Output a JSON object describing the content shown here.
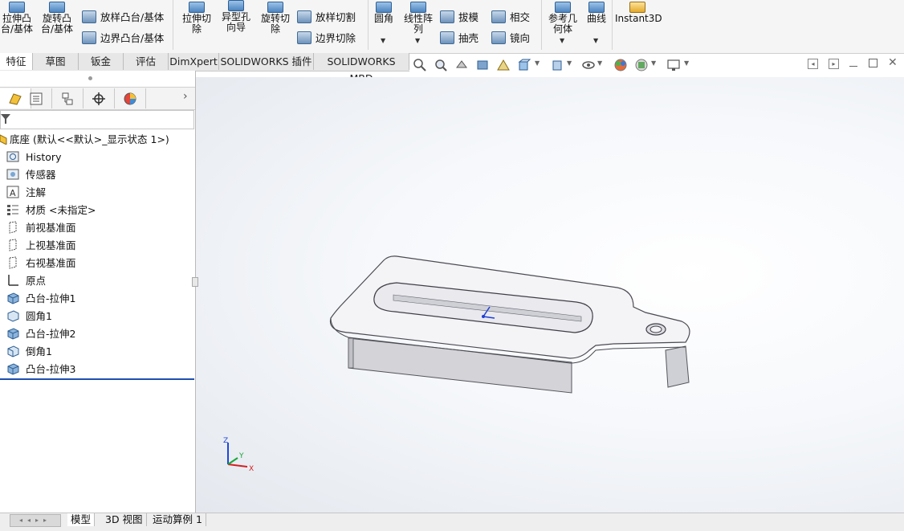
{
  "ribbon": {
    "extrude_boss": "拉伸凸\n台/基体",
    "revolve_boss": "旋转凸\n台/基体",
    "loft_boss": "放样凸台/基体",
    "boundary_boss": "边界凸台/基体",
    "extrude_cut": "拉伸切\n除",
    "hole_wizard": "异型孔\n向导",
    "revolve_cut": "旋转切\n除",
    "loft_cut": "放样切割",
    "boundary_cut": "边界切除",
    "fillet": "圆角",
    "linear_pattern": "线性阵\n列",
    "draft": "拔模",
    "intersect": "相交",
    "shell": "抽壳",
    "mirror": "镜向",
    "ref_geometry": "参考几\n何体",
    "curves": "曲线",
    "instant3d": "Instant3D"
  },
  "tabs": [
    "特征",
    "草图",
    "钣金",
    "评估",
    "DimXpert",
    "SOLIDWORKS 插件",
    "SOLIDWORKS MBD"
  ],
  "active_tab": "特征",
  "tree": {
    "root": "底座 (默认<<默认>_显示状态 1>)",
    "items": [
      {
        "label": "History",
        "icon": "history-icon"
      },
      {
        "label": "传感器",
        "icon": "sensor-icon"
      },
      {
        "label": "注解",
        "icon": "annotation-icon"
      },
      {
        "label": "材质 <未指定>",
        "icon": "material-icon"
      },
      {
        "label": "前视基准面",
        "icon": "plane-icon"
      },
      {
        "label": "上视基准面",
        "icon": "plane-icon"
      },
      {
        "label": "右视基准面",
        "icon": "plane-icon"
      },
      {
        "label": "原点",
        "icon": "origin-icon"
      },
      {
        "label": "凸台-拉伸1",
        "icon": "extrude-feature-icon"
      },
      {
        "label": "圆角1",
        "icon": "fillet-feature-icon"
      },
      {
        "label": "凸台-拉伸2",
        "icon": "extrude-feature-icon"
      },
      {
        "label": "倒角1",
        "icon": "chamfer-feature-icon"
      },
      {
        "label": "凸台-拉伸3",
        "icon": "extrude-feature-icon"
      }
    ]
  },
  "bottom_tabs": [
    "模型",
    "3D 视图",
    "运动算例 1"
  ],
  "active_bottom_tab": "模型",
  "triad": {
    "x": "X",
    "y": "Y",
    "z": "Z"
  },
  "colors": {
    "accent": "#2e5f94",
    "part_face": "#f4f4f6",
    "part_side": "#c9c9cf"
  }
}
